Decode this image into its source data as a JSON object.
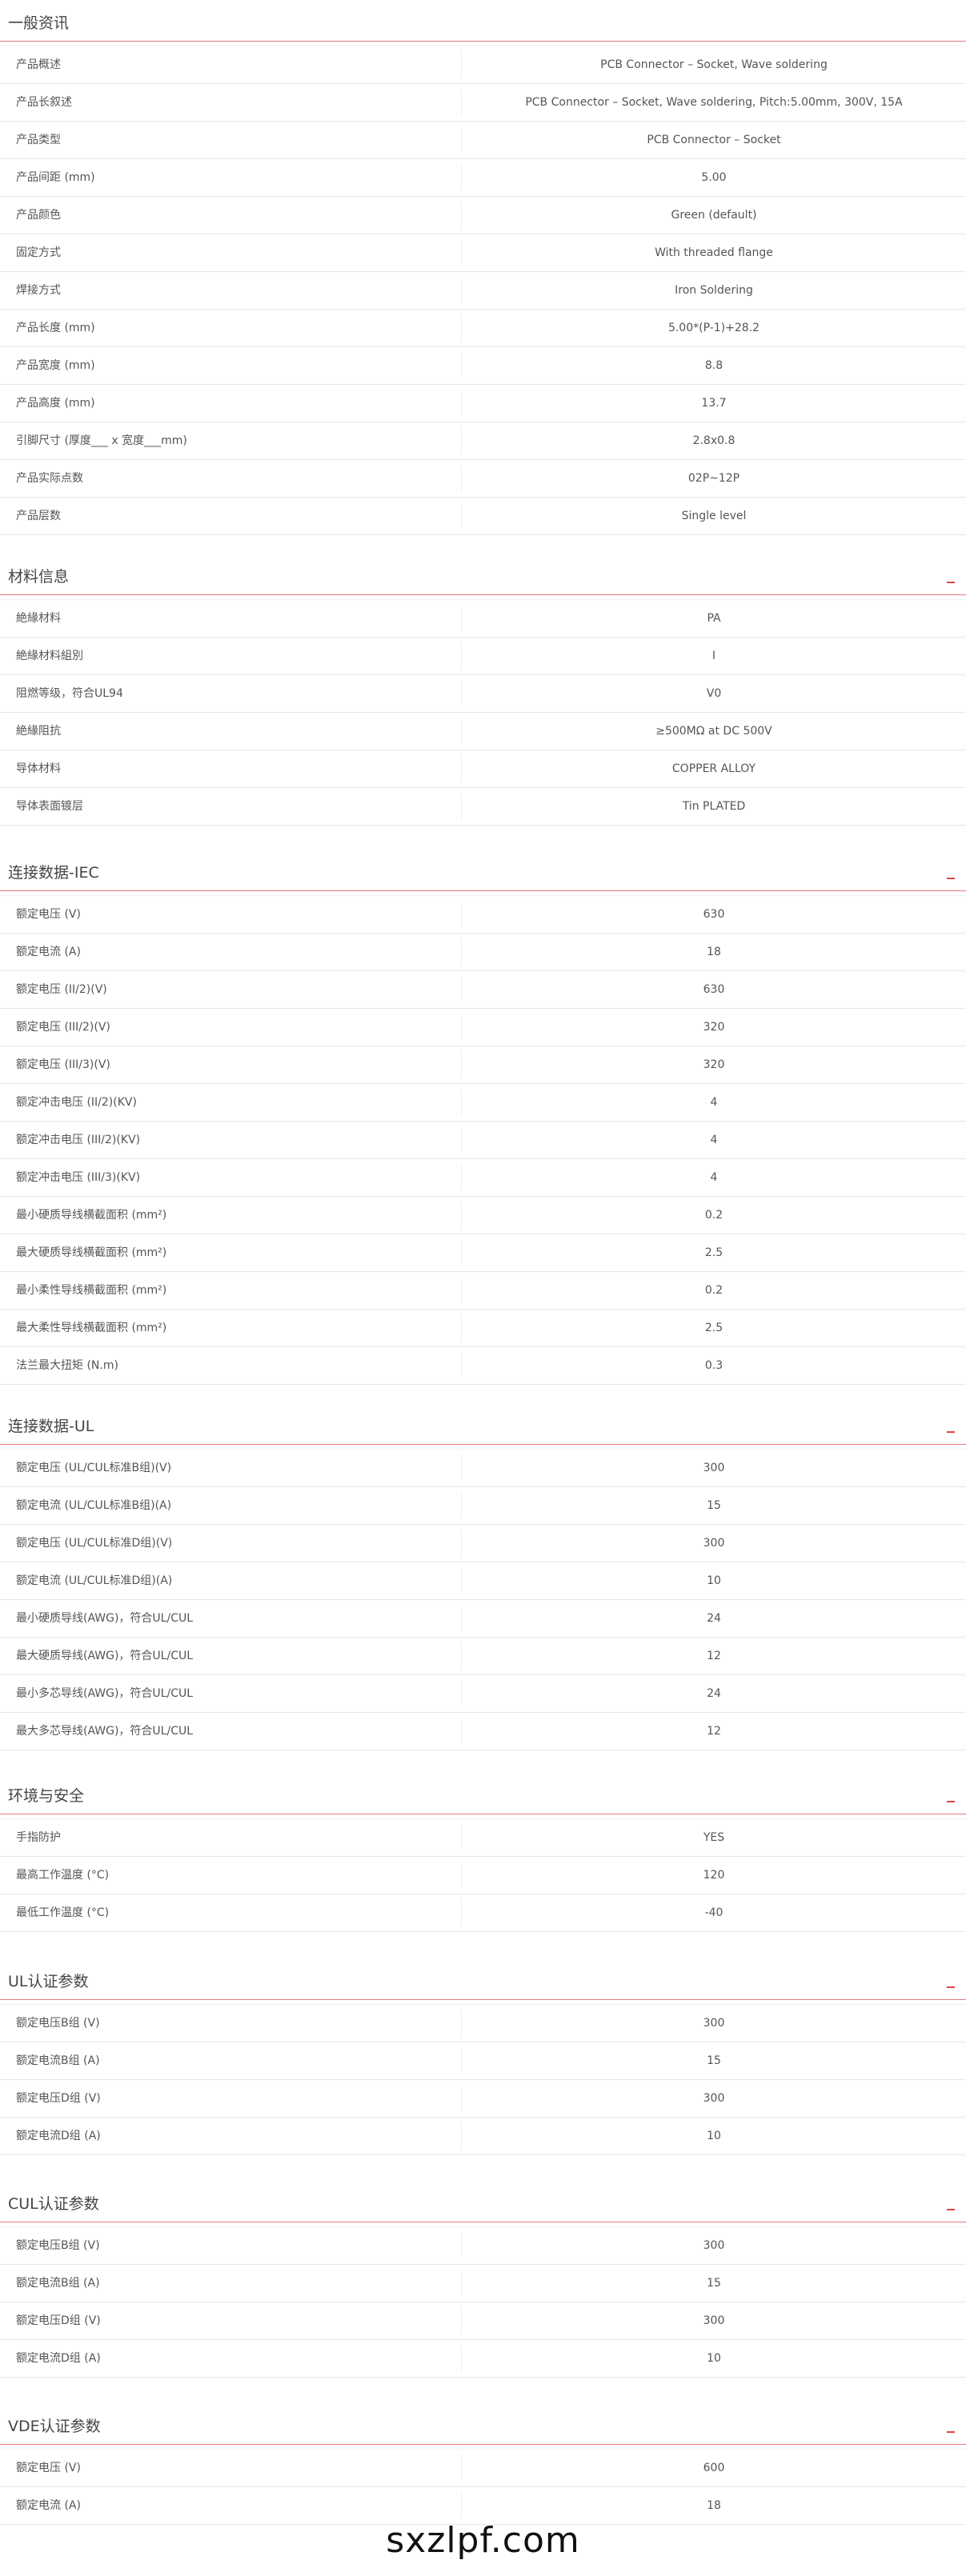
{
  "sections": [
    {
      "title": "一般资讯",
      "top": 0,
      "rows": [
        {
          "label": "产品概述",
          "value": "PCB Connector – Socket, Wave soldering"
        },
        {
          "label": "产品长叙述",
          "value": "PCB Connector – Socket, Wave soldering, Pitch:5.00mm, 300V, 15A"
        },
        {
          "label": "产品类型",
          "value": "PCB Connector – Socket"
        },
        {
          "label": "产品间距 (mm)",
          "value": "5.00"
        },
        {
          "label": "产品颜色",
          "value": "Green (default)"
        },
        {
          "label": "固定方式",
          "value": "With threaded flange"
        },
        {
          "label": "焊接方式",
          "value": "Iron Soldering"
        },
        {
          "label": "产品长度 (mm)",
          "value": "5.00*(P-1)+28.2"
        },
        {
          "label": "产品宽度 (mm)",
          "value": "8.8"
        },
        {
          "label": "产品高度 (mm)",
          "value": "13.7"
        },
        {
          "label": "引脚尺寸 (厚度___ x 宽度___mm)",
          "value": "2.8x0.8"
        },
        {
          "label": "产品实际点数",
          "value": "02P~12P"
        },
        {
          "label": "产品层数",
          "value": "Single level"
        }
      ]
    },
    {
      "title": "材料信息",
      "rows": [
        {
          "label": "絶緣材料",
          "value": "PA"
        },
        {
          "label": "絶緣材料組別",
          "value": "I"
        },
        {
          "label": "阻燃等级，符合UL94",
          "value": "V0"
        },
        {
          "label": "絶緣阻抗",
          "value": "≥500MΩ at DC 500V"
        },
        {
          "label": "导体材料",
          "value": "COPPER ALLOY"
        },
        {
          "label": "导体表面镀层",
          "value": "Tin PLATED"
        }
      ]
    },
    {
      "title": "连接数据-IEC",
      "rows": [
        {
          "label": "额定电压 (V)",
          "value": "630"
        },
        {
          "label": "额定电流 (A)",
          "value": "18"
        },
        {
          "label": "额定电压 (II/2)(V)",
          "value": "630"
        },
        {
          "label": "额定电压 (III/2)(V)",
          "value": "320"
        },
        {
          "label": "额定电压 (III/3)(V)",
          "value": "320"
        },
        {
          "label": "额定冲击电压 (II/2)(KV)",
          "value": "4"
        },
        {
          "label": "额定冲击电压 (III/2)(KV)",
          "value": "4"
        },
        {
          "label": "额定冲击电压 (III/3)(KV)",
          "value": "4"
        },
        {
          "label": "最小硬质导线横截面积 (mm²)",
          "value": "0.2"
        },
        {
          "label": "最大硬质导线横截面积 (mm²)",
          "value": "2.5"
        },
        {
          "label": "最小柔性导线横截面积 (mm²)",
          "value": "0.2"
        },
        {
          "label": "最大柔性导线横截面积 (mm²)",
          "value": "2.5"
        },
        {
          "label": "法兰最大扭矩 (N.m)",
          "value": "0.3"
        }
      ]
    },
    {
      "title": "连接数据-UL",
      "rows": [
        {
          "label": "额定电压 (UL/CUL标准B组)(V)",
          "value": "300"
        },
        {
          "label": "额定电流 (UL/CUL标准B组)(A)",
          "value": "15"
        },
        {
          "label": "额定电压 (UL/CUL标准D组)(V)",
          "value": "300"
        },
        {
          "label": "额定电流 (UL/CUL标准D组)(A)",
          "value": "10"
        },
        {
          "label": "最小硬质导线(AWG)，符合UL/CUL",
          "value": "24"
        },
        {
          "label": "最大硬质导线(AWG)，符合UL/CUL",
          "value": "12"
        },
        {
          "label": "最小多芯导线(AWG)，符合UL/CUL",
          "value": "24"
        },
        {
          "label": "最大多芯导线(AWG)，符合UL/CUL",
          "value": "12"
        }
      ]
    },
    {
      "title": "环境与安全",
      "rows": [
        {
          "label": "手指防护",
          "value": "YES"
        },
        {
          "label": "最高工作温度 (°C)",
          "value": "120"
        },
        {
          "label": "最低工作温度 (°C)",
          "value": "-40"
        }
      ]
    },
    {
      "title": "UL认证参数",
      "rows": [
        {
          "label": "额定电压B组 (V)",
          "value": "300"
        },
        {
          "label": "额定电流B组 (A)",
          "value": "15"
        },
        {
          "label": "额定电压D组 (V)",
          "value": "300"
        },
        {
          "label": "额定电流D组 (A)",
          "value": "10"
        }
      ]
    },
    {
      "title": "CUL认证参数",
      "rows": [
        {
          "label": "额定电压B组 (V)",
          "value": "300"
        },
        {
          "label": "额定电流B组 (A)",
          "value": "15"
        },
        {
          "label": "额定电压D组 (V)",
          "value": "300"
        },
        {
          "label": "额定电流D组 (A)",
          "value": "10"
        }
      ]
    },
    {
      "title": "VDE认证参数",
      "rows": [
        {
          "label": "额定电压 (V)",
          "value": "600"
        },
        {
          "label": "额定电流 (A)",
          "value": "18"
        }
      ]
    }
  ],
  "collapse_symbol": "_",
  "watermark": "sxzlpf.com",
  "colors": {
    "accent": "#e03a3a",
    "rule": "#e77a7a",
    "text": "#555555"
  }
}
